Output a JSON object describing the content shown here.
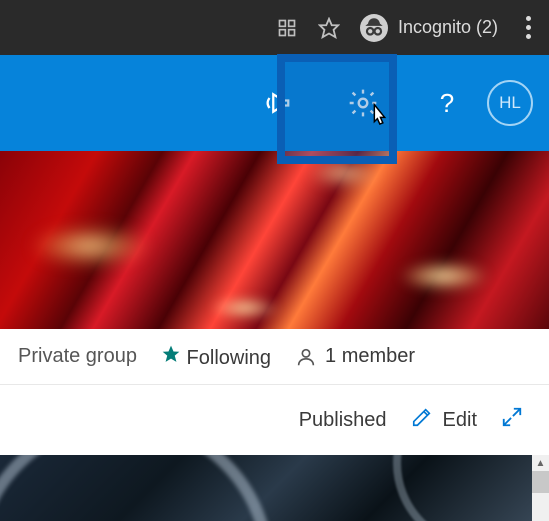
{
  "browser": {
    "incognito_label": "Incognito (2)"
  },
  "header": {
    "user_initials": "HL",
    "help_label": "?"
  },
  "info_bar": {
    "privacy": "Private group",
    "following_label": "Following",
    "member_count": "1 member"
  },
  "action_bar": {
    "status": "Published",
    "edit_label": "Edit"
  }
}
